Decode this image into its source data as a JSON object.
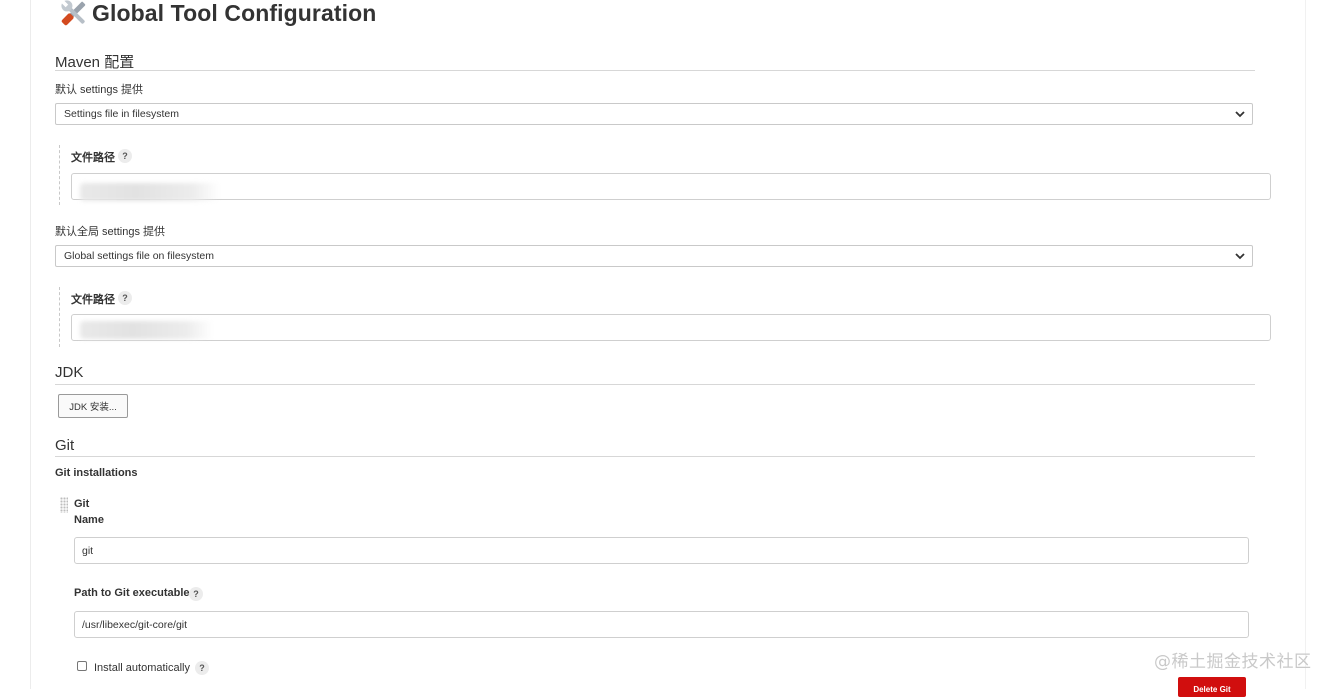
{
  "page": {
    "title": "Global Tool Configuration"
  },
  "maven": {
    "heading": "Maven 配置",
    "default_settings_label": "默认 settings 提供",
    "default_settings_value": "Settings file in filesystem",
    "file_path_label": "文件路径",
    "global_settings_label": "默认全局 settings 提供",
    "global_settings_value": "Global settings file on filesystem",
    "global_file_path_label": "文件路径"
  },
  "help": {
    "symbol": "?"
  },
  "jdk": {
    "heading": "JDK",
    "install_button": "JDK 安装..."
  },
  "git": {
    "heading": "Git",
    "installations_label": "Git installations",
    "entry_title": "Git",
    "name_label": "Name",
    "name_value": "git",
    "path_label": "Path to Git executable",
    "path_value": "/usr/libexec/git-core/git",
    "install_auto_label": "Install automatically",
    "delete_button": "Delete Git"
  },
  "watermark": "@稀土掘金技术社区",
  "colors": {
    "delete_button": "#d10e0e",
    "section_rule": "#d7d7d7"
  }
}
